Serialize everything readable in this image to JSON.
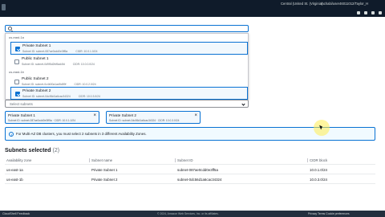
{
  "topbar": {
    "region": "Central (United St. (Virginia)",
    "account": "rachabi/user46011012/Taylor_H"
  },
  "dropdown": {
    "groups": [
      {
        "label": "us-east-1a",
        "options": [
          {
            "name": "Private Subnet 1",
            "id": "Subnet ID: subnet-087ae0cdd0e3ff5a",
            "cidr": "CIDR: 10.0.1.0/24",
            "selected": true
          },
          {
            "name": "Public Subnet 1",
            "id": "Subnet ID: subnet-0d9f5d2fd9ad4fd",
            "cidr": "CIDR: 10.0.0.0/24",
            "selected": false
          }
        ]
      },
      {
        "label": "us-east-1b",
        "options": [
          {
            "name": "Public Subnet 2",
            "id": "Subnet ID: subnet-0c4b00a1ad5d59f",
            "cidr": "CIDR: 10.0.2.0/24",
            "selected": false
          },
          {
            "name": "Private Subnet 2",
            "id": "Subnet ID: subnet-0dc56d1a6cac34324",
            "cidr": "CIDR: 10.0.3.0/24",
            "selected": true
          }
        ]
      }
    ]
  },
  "select": {
    "placeholder": "Select subnets"
  },
  "tokens": [
    {
      "name": "Private Subnet 1",
      "meta": "Subnet ID: subnet-087ae0cdd0e3ff5a · CIDR: 10.0.1.0/24"
    },
    {
      "name": "Private Subnet 2",
      "meta": "Subnet ID: subnet-0dc56d1a6cac34324 · CIDR: 10.0.3.0/24"
    }
  ],
  "info": {
    "text": "For Multi-AZ DB clusters, you must select 2 subnets in 3 different Availability Zones."
  },
  "section": {
    "title": "Subnets selected",
    "count": "(2)"
  },
  "table": {
    "headers": [
      "Availability zone",
      "Subnet name",
      "Subnet ID",
      "CIDR block"
    ],
    "rows": [
      [
        "us-east-1a",
        "Private Subnet 1",
        "subnet-087ae0cdd0e3ff5a",
        "10.0.1.0/24"
      ],
      [
        "us-east-1b",
        "Private Subnet 2",
        "subnet-0dc56d1a6cac34324",
        "10.0.3.0/24"
      ]
    ]
  },
  "footer": {
    "left": "CloudShell   Feedback",
    "mid": "© 2024, Amazon Web Services, Inc. or its affiliates.",
    "right": "Privacy   Terms   Cookie preferences"
  },
  "colors": {
    "accent": "#0972d3",
    "topbar": "#0f1b2a",
    "footer": "#232f3e"
  }
}
